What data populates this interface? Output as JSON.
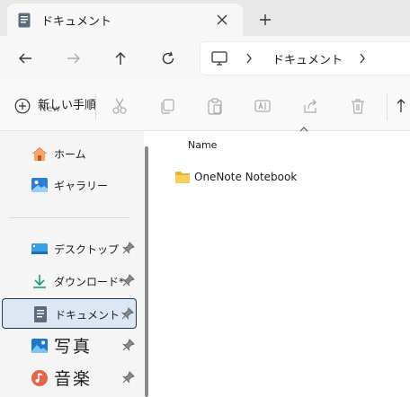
{
  "tab": {
    "title": "ドキュメント",
    "close_icon": "close-icon",
    "new_tab_icon": "plus-icon"
  },
  "nav": {
    "back_icon": "arrow-left-icon",
    "forward_icon": "arrow-right-icon",
    "up_icon": "arrow-up-icon",
    "refresh_icon": "refresh-icon"
  },
  "address": {
    "root_icon": "computer-icon",
    "segment": "ドキュメント"
  },
  "commands": {
    "new_label": "新しい手順",
    "new_ghost": "New",
    "items": [
      "cut-icon",
      "copy-icon",
      "paste-icon",
      "rename-icon",
      "share-icon",
      "delete-icon",
      "sort-icon"
    ]
  },
  "sidebar": {
    "items": [
      {
        "label": "ホーム",
        "icon": "home-icon"
      },
      {
        "label": "ギャラリー",
        "icon": "gallery-icon"
      },
      {
        "label": "デスクトップ",
        "icon": "desktop-icon",
        "pinned": true
      },
      {
        "label": "ダウンロード*",
        "icon": "download-icon",
        "pinned": true
      },
      {
        "label": "ドキュメント",
        "icon": "documents-icon",
        "pinned": true,
        "selected": true
      },
      {
        "label": "写真",
        "icon": "pictures-icon",
        "pinned": true
      },
      {
        "label": "音楽",
        "icon": "music-icon",
        "pinned": true
      }
    ]
  },
  "content": {
    "column_header": "Name",
    "rows": [
      {
        "name": "OneNote Notebook",
        "icon": "folder-icon"
      }
    ]
  },
  "colors": {
    "accent": "#0067c0",
    "folder": "#f2c14e",
    "selected_bg": "#dde6f3"
  }
}
